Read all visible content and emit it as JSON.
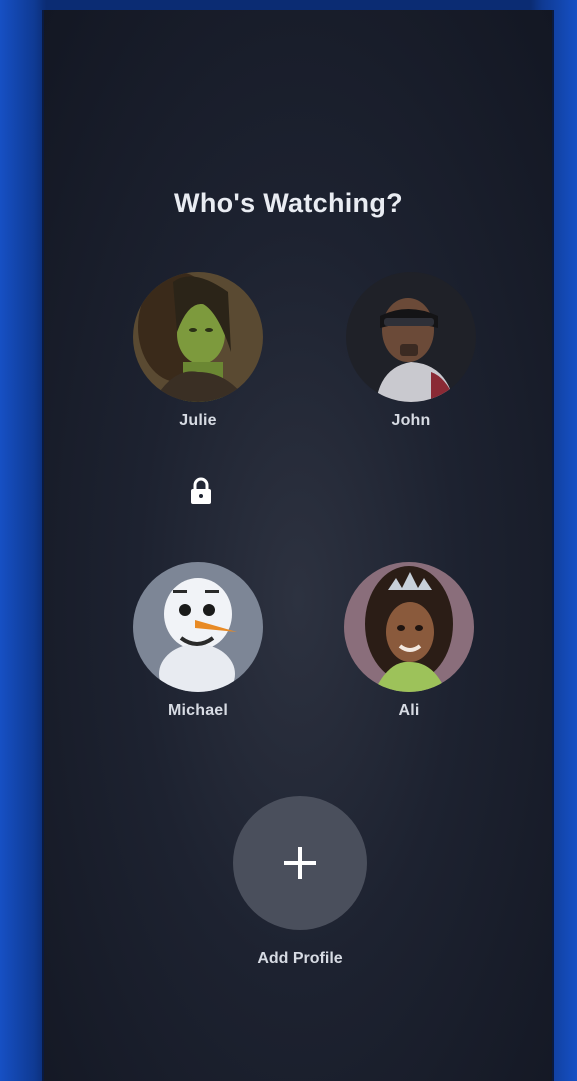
{
  "heading": "Who's Watching?",
  "profiles": [
    {
      "name": "Julie",
      "avatar_icon": "green-hero-avatar-icon",
      "locked": true
    },
    {
      "name": "John",
      "avatar_icon": "masked-hero-avatar-icon",
      "locked": false
    },
    {
      "name": "Michael",
      "avatar_icon": "snowman-avatar-icon",
      "locked": false
    },
    {
      "name": "Ali",
      "avatar_icon": "princess-avatar-icon",
      "locked": false
    }
  ],
  "add_profile": {
    "label": "Add Profile",
    "icon": "plus-icon"
  },
  "colors": {
    "background": "#1d2230",
    "frame_blue": "#1650c4",
    "add_circle": "#4a4f5c",
    "text": "#e9ecf2"
  }
}
